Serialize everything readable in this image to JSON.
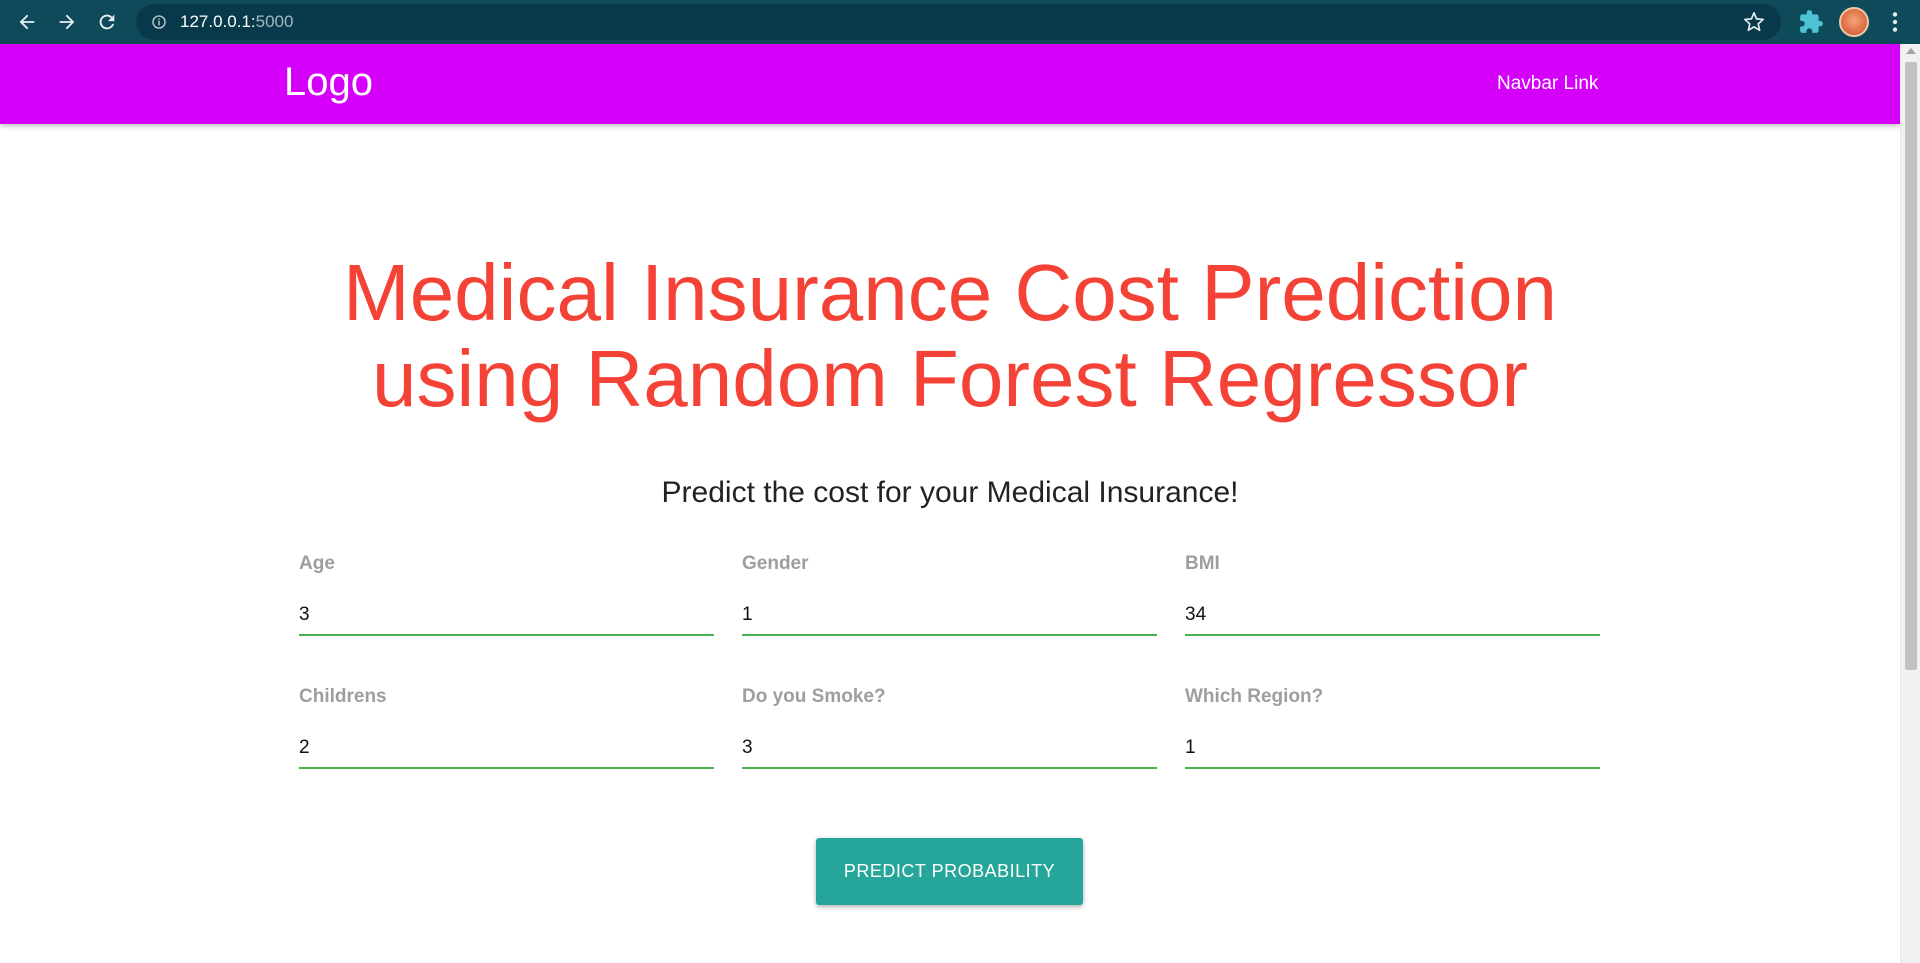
{
  "browser": {
    "url_host": "127.0.0.1:",
    "url_port": "5000"
  },
  "navbar": {
    "logo": "Logo",
    "link": "Navbar Link",
    "background_color": "#d500f9"
  },
  "main": {
    "title_line1": "Medical Insurance Cost Prediction",
    "title_line2": "using Random Forest Regressor",
    "subtitle": "Predict the cost for your Medical Insurance!",
    "title_color": "#f44336"
  },
  "form": {
    "fields": [
      {
        "label": "Age",
        "value": "3"
      },
      {
        "label": "Gender",
        "value": "1"
      },
      {
        "label": "BMI",
        "value": "34"
      },
      {
        "label": "Childrens",
        "value": "2"
      },
      {
        "label": "Do you Smoke?",
        "value": "3"
      },
      {
        "label": "Which Region?",
        "value": "1"
      }
    ],
    "submit_label": "Predict Probability",
    "button_color": "#26a69a",
    "underline_color": "#4caf50"
  },
  "icons": {
    "back": "back-arrow-icon",
    "forward": "forward-arrow-icon",
    "reload": "reload-icon",
    "info": "info-icon",
    "star": "star-icon",
    "extensions": "puzzle-icon",
    "menu": "kebab-menu-icon"
  }
}
